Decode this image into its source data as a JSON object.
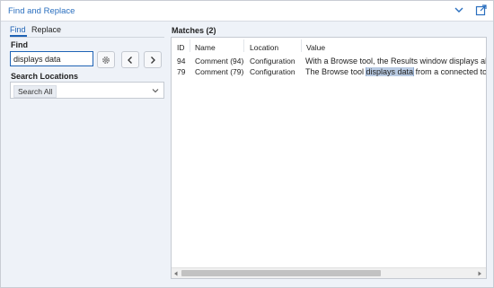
{
  "window": {
    "title": "Find and Replace"
  },
  "tabs": [
    {
      "label": "Find"
    },
    {
      "label": "Replace"
    }
  ],
  "find": {
    "label": "Find",
    "value": "displays data"
  },
  "locations": {
    "label": "Search Locations",
    "selected": "Search All"
  },
  "matches": {
    "heading": "Matches (2)",
    "columns": [
      "ID",
      "Name",
      "Location",
      "Value"
    ],
    "rows": [
      {
        "id": "94",
        "name": "Comment (94)",
        "location": "Configuration",
        "value_before": "With a Browse tool, the Results window displays all data",
        "value_match": "",
        "value_after": ""
      },
      {
        "id": "79",
        "name": "Comment (79)",
        "location": "Configuration",
        "value_before": "The Browse tool ",
        "value_match": "displays data",
        "value_after": " from a connected tool as"
      }
    ]
  },
  "icons": {
    "title_chevron": "chevron-down-icon",
    "title_popout": "popout-icon",
    "settings": "gear-icon",
    "prev": "chevron-left-icon",
    "next": "chevron-right-icon"
  },
  "colors": {
    "accent": "#1f63b5",
    "highlight": "#b9cbe3"
  }
}
